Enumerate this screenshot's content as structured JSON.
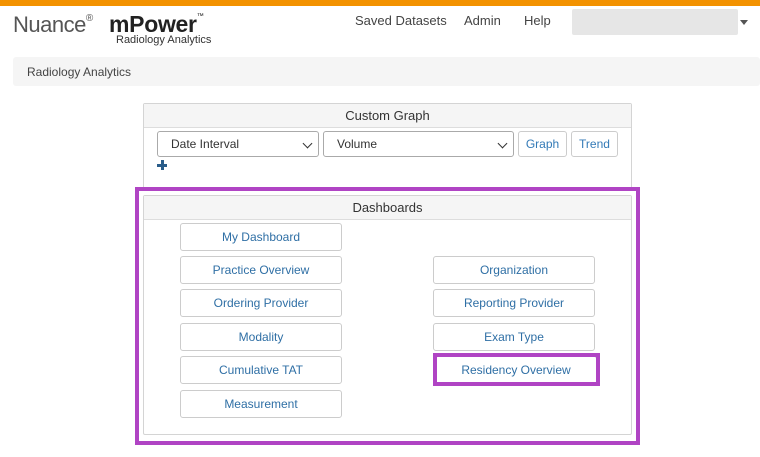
{
  "header": {
    "logo": {
      "brand": "Nuance",
      "reg": "®",
      "product": "mPower",
      "tm": "™",
      "subtitle": "Radiology Analytics"
    },
    "nav": [
      "Saved Datasets",
      "Admin",
      "Help"
    ],
    "user_menu": {
      "value": ""
    }
  },
  "breadcrumb": {
    "label": "Radiology Analytics"
  },
  "custom_graph": {
    "title": "Custom Graph",
    "date_select": "Date Interval",
    "metric_select": "Volume",
    "graph_button": "Graph",
    "trend_button": "Trend"
  },
  "dashboards": {
    "title": "Dashboards",
    "left": [
      "My Dashboard",
      "Practice Overview",
      "Ordering Provider",
      "Modality",
      "Cumulative TAT",
      "Measurement"
    ],
    "right": [
      "Organization",
      "Reporting Provider",
      "Exam Type",
      "Residency Overview"
    ]
  },
  "colors": {
    "accent_bar": "#f39200",
    "highlight": "#b044c4",
    "link": "#2f6fa5"
  }
}
